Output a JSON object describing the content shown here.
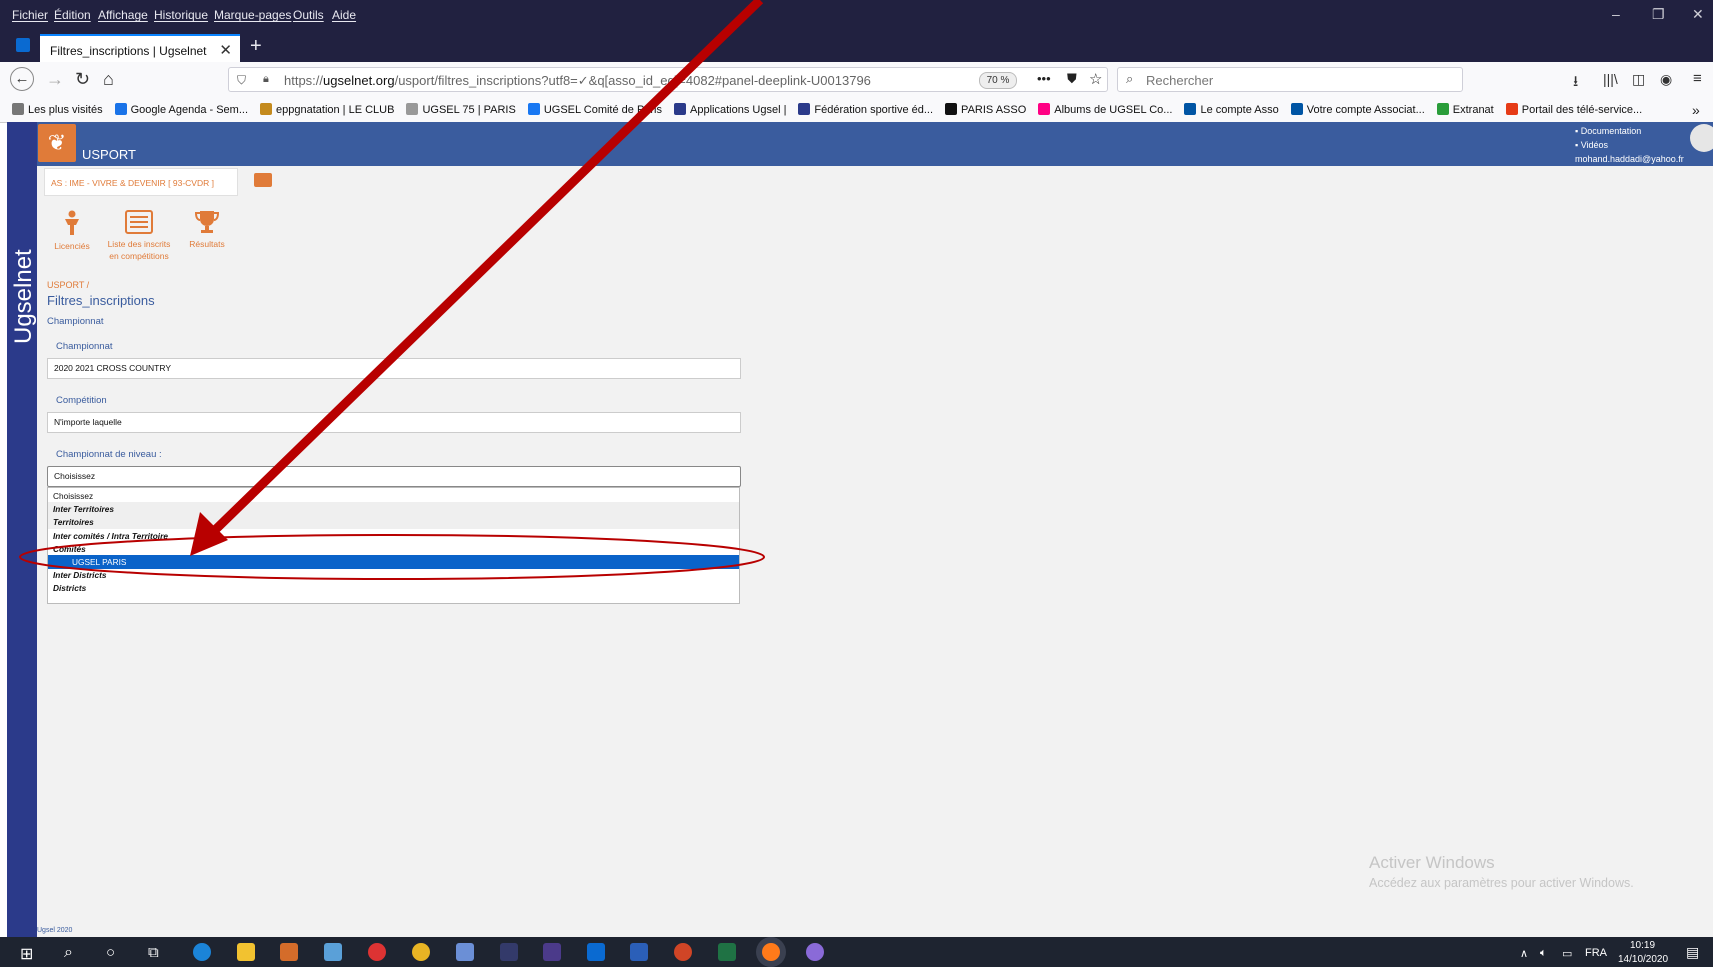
{
  "menubar": {
    "items": [
      "Fichier",
      "Édition",
      "Affichage",
      "Historique",
      "Marque-pages",
      "Outils",
      "Aide"
    ]
  },
  "tab": {
    "title": "Filtres_inscriptions | Ugselnet",
    "close": "✕",
    "new": "+"
  },
  "url": {
    "domain": "ugselnet.org",
    "prefix": "https://",
    "path": "/usport/filtres_inscriptions?utf8=✓&q[asso_id_eq]=4082#panel-deeplink-U0013796",
    "zoom": "70 %"
  },
  "search": {
    "placeholder": "Rechercher"
  },
  "bookmarks": [
    {
      "label": "Les plus visités",
      "color": "#777777"
    },
    {
      "label": "Google Agenda - Sem...",
      "color": "#1a73e8"
    },
    {
      "label": "eppgnatation | LE CLUB",
      "color": "#c48a1d"
    },
    {
      "label": "UGSEL 75 | PARIS",
      "color": "#999999"
    },
    {
      "label": "UGSEL Comité de Paris",
      "color": "#1877f2"
    },
    {
      "label": "Applications Ugsel |",
      "color": "#2b3a8a"
    },
    {
      "label": "Fédération sportive éd...",
      "color": "#2b3a8a"
    },
    {
      "label": "PARIS ASSO",
      "color": "#111111"
    },
    {
      "label": "Albums de UGSEL Co...",
      "color": "#ff0084"
    },
    {
      "label": "Le compte Asso",
      "color": "#0055a4"
    },
    {
      "label": "Votre compte Associat...",
      "color": "#0055a4"
    },
    {
      "label": "Extranat",
      "color": "#2a9d3a"
    },
    {
      "label": "Portail des télé-service...",
      "color": "#e63b17"
    }
  ],
  "site": {
    "brand": "Ugselnet",
    "app_name": "USPORT",
    "right_links": [
      "Documentation",
      "Vidéos",
      "mohand.haddadi@yahoo.fr"
    ],
    "as_tab": "AS : IME - VIVRE & DEVENIR [ 93-CVDR ]",
    "quick_links": [
      "Licenciés",
      "Liste des inscrits en compétitions",
      "Résultats"
    ],
    "breadcrumb": "USPORT /",
    "page_title": "Filtres_inscriptions",
    "page_subtitle": "Championnat",
    "footer": "Ugsel 2020"
  },
  "form": {
    "championnat_label": "Championnat",
    "championnat_value": "2020 2021 CROSS COUNTRY",
    "competition_label": "Compétition",
    "competition_value": "N'importe laquelle",
    "niveau_label": "Championnat de niveau :",
    "niveau_value": "Choisissez",
    "options": [
      {
        "label": "Choisissez",
        "type": "opt"
      },
      {
        "label": "Inter Territoires",
        "type": "grp"
      },
      {
        "label": "Territoires",
        "type": "grp"
      },
      {
        "label": "Inter comités  / Intra Territoire",
        "type": "grp"
      },
      {
        "label": "Comités",
        "type": "grp"
      },
      {
        "label": "UGSEL PARIS",
        "type": "sel"
      },
      {
        "label": "Inter Districts",
        "type": "grp"
      },
      {
        "label": "Districts",
        "type": "grp"
      }
    ]
  },
  "watermark": {
    "title": "Activer Windows",
    "subtitle": "Accédez aux paramètres pour activer Windows."
  },
  "taskbar": {
    "lang": "FRA",
    "time": "10:19",
    "date": "14/10/2020"
  },
  "colors": {
    "accent_orange": "#e07b39",
    "site_blue": "#3a5c9e",
    "annotation_red": "#b80000"
  }
}
